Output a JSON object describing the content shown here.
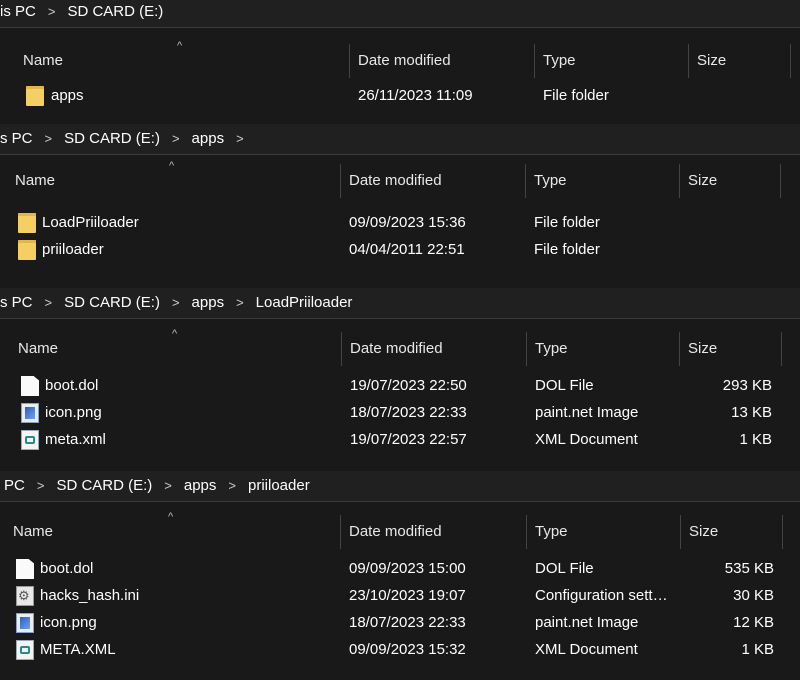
{
  "columns": {
    "name": "Name",
    "date": "Date modified",
    "type": "Type",
    "size": "Size"
  },
  "panels": [
    {
      "breadcrumb": [
        "is PC",
        "SD CARD (E:)"
      ],
      "rows": [
        {
          "icon": "folder",
          "name": "apps",
          "date": "26/11/2023 11:09",
          "type": "File folder",
          "size": ""
        }
      ]
    },
    {
      "breadcrumb": [
        "s PC",
        "SD CARD (E:)",
        "apps"
      ],
      "rows": [
        {
          "icon": "folder",
          "name": "LoadPriiloader",
          "date": "09/09/2023 15:36",
          "type": "File folder",
          "size": ""
        },
        {
          "icon": "folder",
          "name": "priiloader",
          "date": "04/04/2011 22:51",
          "type": "File folder",
          "size": ""
        }
      ]
    },
    {
      "breadcrumb": [
        "s PC",
        "SD CARD (E:)",
        "apps",
        "LoadPriiloader"
      ],
      "rows": [
        {
          "icon": "file",
          "name": "boot.dol",
          "date": "19/07/2023 22:50",
          "type": "DOL File",
          "size": "293 KB"
        },
        {
          "icon": "png",
          "name": "icon.png",
          "date": "18/07/2023 22:33",
          "type": "paint.net Image",
          "size": "13 KB"
        },
        {
          "icon": "xml",
          "name": "meta.xml",
          "date": "19/07/2023 22:57",
          "type": "XML Document",
          "size": "1 KB"
        }
      ]
    },
    {
      "breadcrumb": [
        "PC",
        "SD CARD (E:)",
        "apps",
        "priiloader"
      ],
      "rows": [
        {
          "icon": "file",
          "name": "boot.dol",
          "date": "09/09/2023 15:00",
          "type": "DOL File",
          "size": "535 KB"
        },
        {
          "icon": "ini",
          "name": "hacks_hash.ini",
          "date": "23/10/2023 19:07",
          "type": "Configuration sett…",
          "size": "30 KB"
        },
        {
          "icon": "png",
          "name": "icon.png",
          "date": "18/07/2023 22:33",
          "type": "paint.net Image",
          "size": "12 KB"
        },
        {
          "icon": "xml",
          "name": "META.XML",
          "date": "09/09/2023 15:32",
          "type": "XML Document",
          "size": "1 KB"
        }
      ]
    }
  ]
}
